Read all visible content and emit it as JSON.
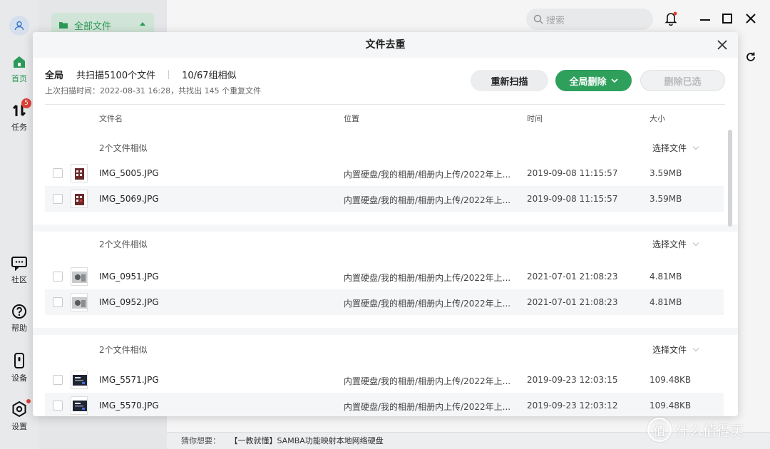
{
  "nav": {
    "items": [
      {
        "label": "首页",
        "icon": "home-icon",
        "active": true
      },
      {
        "label": "任务",
        "icon": "transfer-icon",
        "badge": "5"
      },
      {
        "label": "社区",
        "icon": "community-icon"
      },
      {
        "label": "帮助",
        "icon": "help-icon"
      },
      {
        "label": "设备",
        "icon": "device-icon"
      },
      {
        "label": "设置",
        "icon": "settings-icon"
      }
    ]
  },
  "sidebar": {
    "all_files_label": "全部文件"
  },
  "topbar": {
    "search_placeholder": "搜索"
  },
  "dialog": {
    "title": "文件去重",
    "summary": {
      "scope": "全局",
      "scanned": "共扫描5100个文件",
      "groups": "10/67组相似",
      "last_scan": "上次扫描时间：2022-08-31 16:28，共找出 145 个重复文件"
    },
    "buttons": {
      "rescan": "重新扫描",
      "global_delete": "全局删除",
      "delete_selected": "删除已选"
    },
    "columns": {
      "name": "文件名",
      "location": "位置",
      "time": "时间",
      "size": "大小"
    },
    "groups": [
      {
        "label": "2个文件相似",
        "select_label": "选择文件",
        "files": [
          {
            "name": "IMG_5005.JPG",
            "location": "内置硬盘/我的相册/相册内上传/2022年上...",
            "time": "2019-09-08 11:15:57",
            "size": "3.59MB"
          },
          {
            "name": "IMG_5069.JPG",
            "location": "内置硬盘/我的相册/相册内上传/2022年上...",
            "time": "2019-09-08 11:15:57",
            "size": "3.59MB"
          }
        ]
      },
      {
        "label": "2个文件相似",
        "select_label": "选择文件",
        "files": [
          {
            "name": "IMG_0951.JPG",
            "location": "内置硬盘/我的相册/相册内上传/2022年上...",
            "time": "2021-07-01 21:08:23",
            "size": "4.81MB"
          },
          {
            "name": "IMG_0952.JPG",
            "location": "内置硬盘/我的相册/相册内上传/2022年上...",
            "time": "2021-07-01 21:08:23",
            "size": "4.81MB"
          }
        ]
      },
      {
        "label": "2个文件相似",
        "select_label": "选择文件",
        "files": [
          {
            "name": "IMG_5571.JPG",
            "location": "内置硬盘/我的相册/相册内上传/2022年上...",
            "time": "2019-09-23 12:03:15",
            "size": "109.48KB"
          },
          {
            "name": "IMG_5570.JPG",
            "location": "内置硬盘/我的相册/相册内上传/2022年上...",
            "time": "2019-09-23 12:03:12",
            "size": "109.48KB"
          }
        ]
      }
    ]
  },
  "bottom": {
    "guess_label": "猜你想要：",
    "suggestion": "【一教就懂】SAMBA功能映射本地网络硬盘"
  },
  "watermark": {
    "logo": "值",
    "text": "什么值得买"
  },
  "colors": {
    "accent": "#2ea05c",
    "badge": "#e8433c"
  }
}
